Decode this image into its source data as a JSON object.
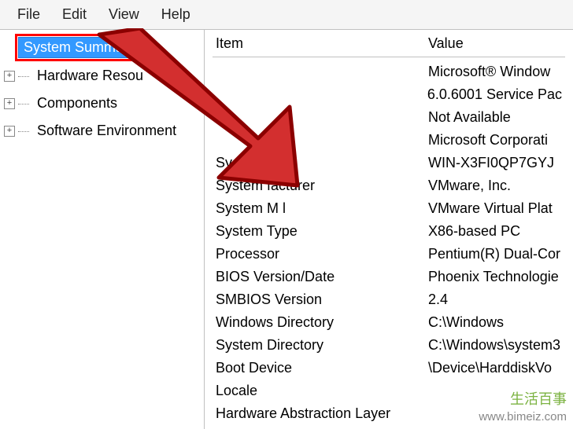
{
  "menubar": {
    "items": [
      "File",
      "Edit",
      "View",
      "Help"
    ]
  },
  "sidebar": {
    "nodes": [
      {
        "label": "System Summary",
        "selected": true,
        "expandable": false
      },
      {
        "label": "Hardware Resou",
        "selected": false,
        "expandable": true
      },
      {
        "label": "Components",
        "selected": false,
        "expandable": true
      },
      {
        "label": "Software Environment",
        "selected": false,
        "expandable": true
      }
    ]
  },
  "table": {
    "headers": {
      "item": "Item",
      "value": "Value"
    },
    "rows": [
      {
        "item": "",
        "value": "Microsoft® Window"
      },
      {
        "item": "",
        "value": "6.0.6001 Service Pac"
      },
      {
        "item": "",
        "value": "Not Available"
      },
      {
        "item": "",
        "value": "Microsoft Corporati"
      },
      {
        "item": "Sys",
        "value": "WIN-X3FI0QP7GYJ"
      },
      {
        "item": "System          facturer",
        "value": "VMware, Inc."
      },
      {
        "item": "System M        l",
        "value": "VMware Virtual Plat"
      },
      {
        "item": "System Type",
        "value": "X86-based PC"
      },
      {
        "item": "Processor",
        "value": "Pentium(R) Dual-Cor"
      },
      {
        "item": "BIOS Version/Date",
        "value": "Phoenix Technologie"
      },
      {
        "item": "SMBIOS Version",
        "value": "2.4"
      },
      {
        "item": "Windows Directory",
        "value": "C:\\Windows"
      },
      {
        "item": "System Directory",
        "value": "C:\\Windows\\system3"
      },
      {
        "item": "Boot Device",
        "value": "\\Device\\HarddiskVo"
      },
      {
        "item": "Locale",
        "value": ""
      },
      {
        "item": "Hardware Abstraction Layer",
        "value": ""
      }
    ]
  },
  "watermark": {
    "brand": "生活百事",
    "url": "www.bimeiz.com"
  }
}
